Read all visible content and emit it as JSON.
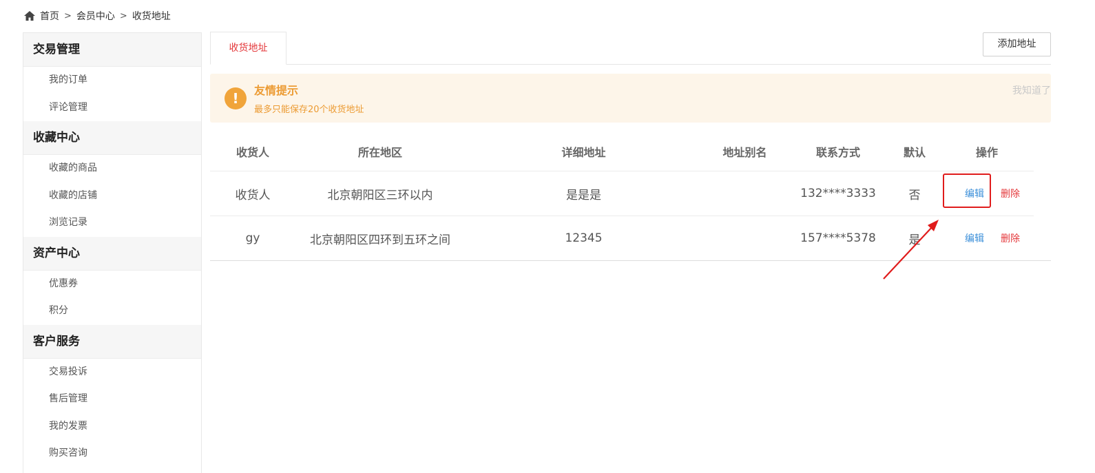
{
  "breadcrumb": {
    "items": [
      "首页",
      "会员中心",
      "收货地址"
    ],
    "sep": ">"
  },
  "sidebar": {
    "groups": [
      {
        "title": "交易管理",
        "items": [
          "我的订单",
          "评论管理"
        ]
      },
      {
        "title": "收藏中心",
        "items": [
          "收藏的商品",
          "收藏的店铺",
          "浏览记录"
        ]
      },
      {
        "title": "资产中心",
        "items": [
          "优惠券",
          "积分"
        ]
      },
      {
        "title": "客户服务",
        "items": [
          "交易投诉",
          "售后管理",
          "我的发票",
          "购买咨询"
        ]
      }
    ]
  },
  "main": {
    "tab_label": "收货地址",
    "add_button": "添加地址",
    "notice": {
      "icon_glyph": "!",
      "title": "友情提示",
      "desc": "最多只能保存20个收货地址",
      "dismiss": "我知道了"
    },
    "table": {
      "headers": [
        "收货人",
        "所在地区",
        "详细地址",
        "地址别名",
        "联系方式",
        "默认",
        "操作"
      ],
      "rows": [
        {
          "name": "收货人",
          "region": "北京朝阳区三环以内",
          "detail": "是是是",
          "alias": "",
          "phone": "132****3333",
          "default": "否",
          "edit": "编辑",
          "delete": "删除"
        },
        {
          "name": "gy",
          "region": "北京朝阳区四环到五环之间",
          "detail": "12345",
          "alias": "",
          "phone": "157****5378",
          "default": "是",
          "edit": "编辑",
          "delete": "删除"
        }
      ]
    }
  },
  "colors": {
    "accent_red": "#e4393c",
    "link_blue": "#3b8fd9",
    "notice_orange": "#ec9b33",
    "notice_bg": "#fdf5e9",
    "annotation_red": "#e01b1b"
  },
  "icons": {
    "breadcrumb_home": "home-icon",
    "notice": "warning-icon"
  }
}
